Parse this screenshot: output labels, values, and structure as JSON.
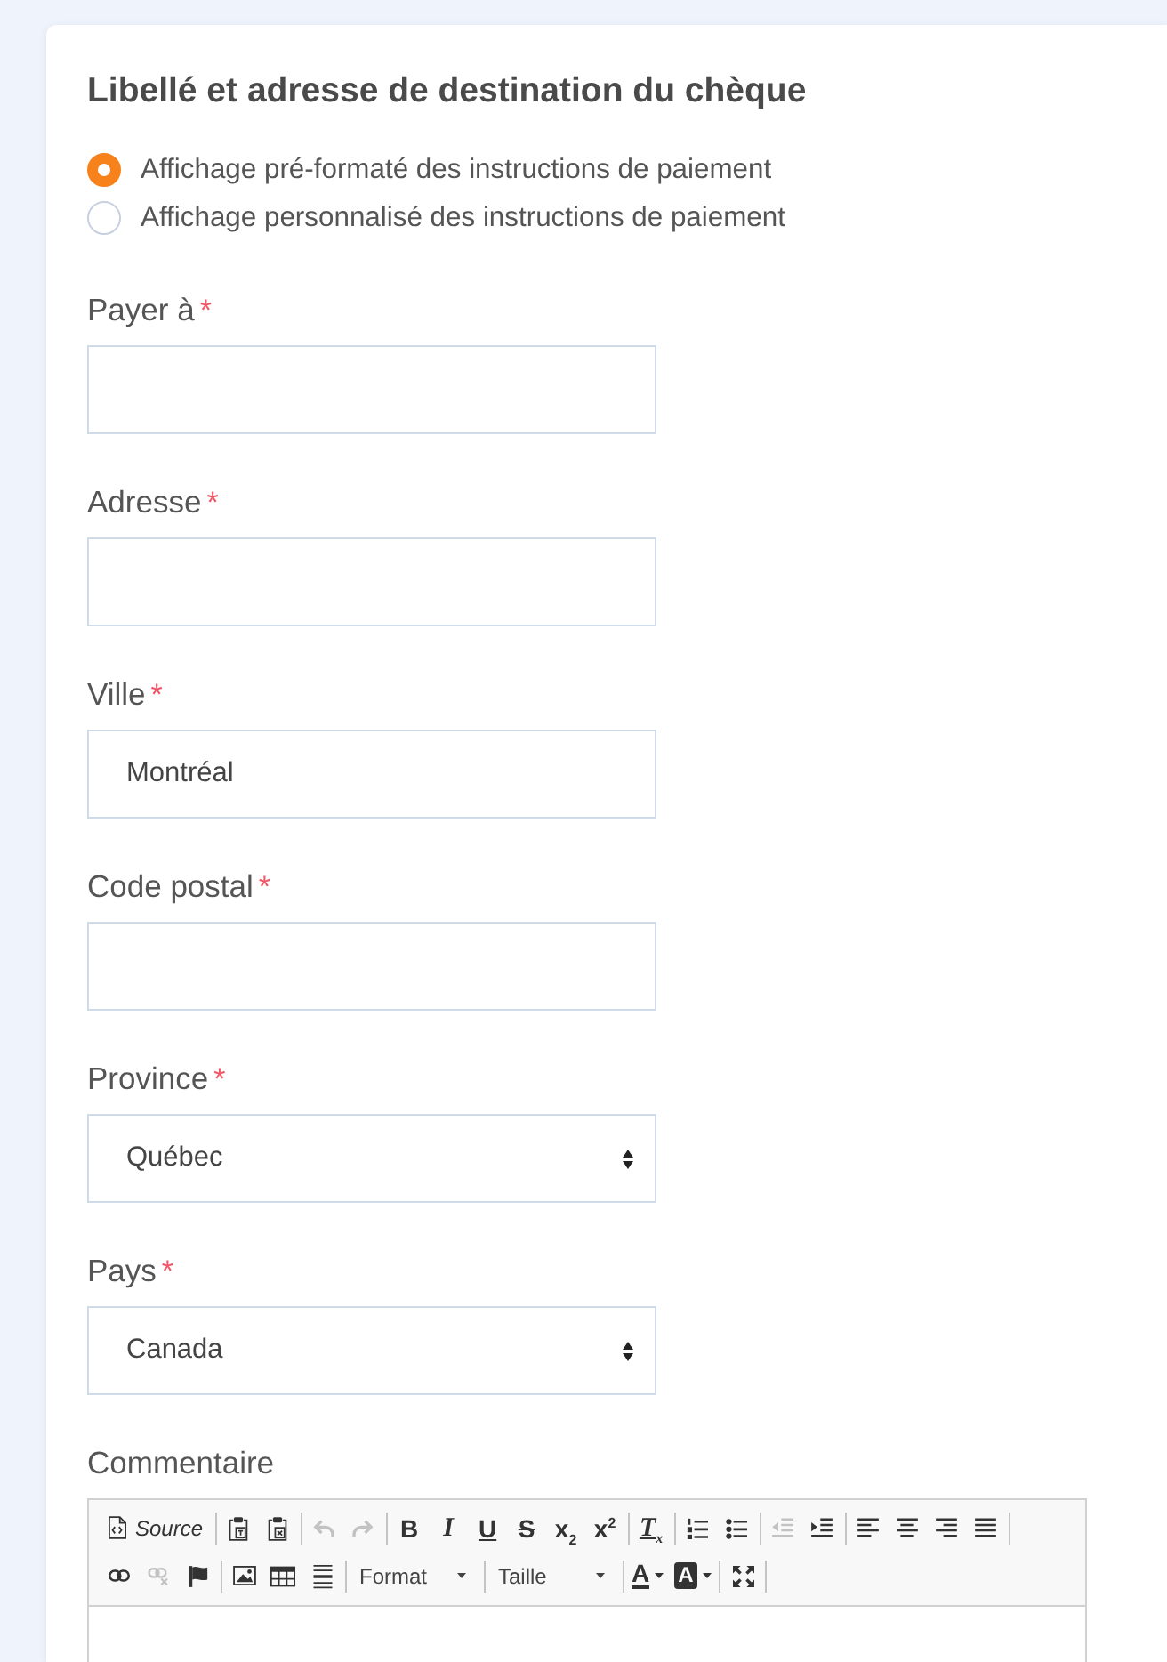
{
  "title": "Libellé et adresse de destination du chèque",
  "display_options": [
    {
      "label": "Affichage pré-formaté des instructions de paiement",
      "selected": true
    },
    {
      "label": "Affichage personnalisé des instructions de paiement",
      "selected": false
    }
  ],
  "fields": [
    {
      "kind": "text",
      "label": "Payer à",
      "required_mark": "*"
    },
    {
      "kind": "text",
      "label": "Adresse",
      "required_mark": "*"
    },
    {
      "kind": "text",
      "label": "Ville",
      "required_mark": "*",
      "value": "Montréal"
    },
    {
      "kind": "text",
      "label": "Code postal",
      "required_mark": "*"
    },
    {
      "kind": "select",
      "label": "Province",
      "required_mark": "*",
      "value": "Québec"
    },
    {
      "kind": "select",
      "label": "Pays",
      "required_mark": "*",
      "value": "Canada"
    }
  ],
  "comment": {
    "label": "Commentaire",
    "toolbar_rows": [
      {
        "groups": [
          {
            "items": [
              {
                "kind": "source",
                "label": "Source",
                "disabled": false
              }
            ]
          },
          {
            "items": [
              {
                "kind": "paste-text",
                "disabled": false
              },
              {
                "kind": "paste-word",
                "disabled": false
              }
            ]
          },
          {
            "items": [
              {
                "kind": "undo",
                "disabled": true
              },
              {
                "kind": "redo",
                "disabled": true
              }
            ]
          },
          {
            "items": [
              {
                "kind": "bold",
                "glyph": "B",
                "disabled": false
              },
              {
                "kind": "italic",
                "glyph": "I",
                "disabled": false
              },
              {
                "kind": "underline",
                "glyph": "U",
                "disabled": false
              },
              {
                "kind": "strike",
                "glyph": "S",
                "disabled": false
              },
              {
                "kind": "subscript",
                "glyph": "x$_{2}$",
                "disabled": false
              },
              {
                "kind": "superscript",
                "glyph": "x$^{2}$",
                "disabled": false
              }
            ]
          },
          {
            "items": [
              {
                "kind": "remove-format",
                "glyph": "T$_{x}$",
                "disabled": false
              }
            ]
          },
          {
            "items": [
              {
                "kind": "numbered-list",
                "disabled": false
              },
              {
                "kind": "bullet-list",
                "disabled": false
              }
            ]
          },
          {
            "items": [
              {
                "kind": "outdent",
                "disabled": true
              },
              {
                "kind": "indent",
                "disabled": false
              }
            ]
          },
          {
            "items": [
              {
                "kind": "align-left",
                "disabled": false
              },
              {
                "kind": "align-center",
                "disabled": false
              },
              {
                "kind": "align-right",
                "disabled": false
              },
              {
                "kind": "justify",
                "disabled": false
              }
            ]
          }
        ]
      },
      {
        "groups": [
          {
            "items": [
              {
                "kind": "link",
                "disabled": false
              },
              {
                "kind": "unlink",
                "disabled": true
              },
              {
                "kind": "anchor",
                "disabled": false
              }
            ]
          },
          {
            "items": [
              {
                "kind": "image",
                "disabled": false
              },
              {
                "kind": "table",
                "disabled": false
              },
              {
                "kind": "horizontal-rule",
                "disabled": false
              }
            ]
          },
          {
            "items": [
              {
                "kind": "format",
                "label": "Format",
                "disabled": false
              }
            ]
          },
          {
            "items": [
              {
                "kind": "size",
                "label": "Taille",
                "disabled": false
              }
            ]
          },
          {
            "items": [
              {
                "kind": "text-color",
                "glyph": "A",
                "disabled": false
              },
              {
                "kind": "background-color",
                "glyph": "A",
                "disabled": false
              }
            ]
          },
          {
            "items": [
              {
                "kind": "maximize",
                "disabled": false
              }
            ]
          }
        ]
      }
    ]
  }
}
